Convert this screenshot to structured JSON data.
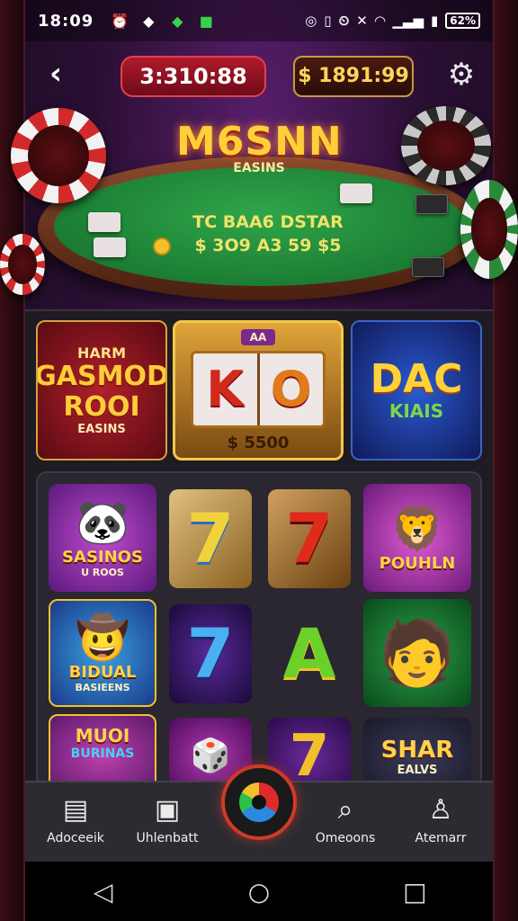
{
  "status_bar": {
    "time": "18:09",
    "icons": [
      "alarm-icon",
      "notification-icon",
      "game-icon",
      "chat-icon"
    ],
    "right_icons": [
      "nfc-icon",
      "vibrate-icon",
      "alarm-icon",
      "mute-icon",
      "wifi-icon",
      "signal-icon",
      "sim-icon"
    ],
    "battery": "62%"
  },
  "top_bar": {
    "back_icon": "back-arrow-icon",
    "balance_left": "3:310:88",
    "balance_right": "$ 1891:99",
    "settings_icon": "gear-icon"
  },
  "hero": {
    "logo_title": "M6SNN",
    "logo_subtitle": "EASINS",
    "felt_line1": "TC BAA6 DSTAR",
    "felt_line2": "$ 3O9 A3 59 $5"
  },
  "featured": [
    {
      "top": "HARM",
      "title": "GASMOD ROOI",
      "sub": "EASINS"
    },
    {
      "badge": "AA",
      "reel1": "K",
      "reel2": "O",
      "amount": "$ 5500"
    },
    {
      "title": "DAC",
      "sub": "KIAIS"
    }
  ],
  "grid": [
    {
      "caption": "SASINOS",
      "sub": "U ROOS"
    },
    {
      "symbol": "7"
    },
    {
      "symbol": "7"
    },
    {
      "caption": "POUHLN",
      "sub": ""
    },
    {
      "caption": "BIDUAL",
      "sub": "BASIEENS"
    },
    {
      "symbol": "7"
    },
    {
      "symbol": "A"
    },
    {
      "caption": "",
      "sub": ""
    },
    {
      "caption": "MUOI",
      "sub": "BURINAS"
    },
    {
      "caption": "",
      "sub": ""
    },
    {
      "symbol": "7"
    },
    {
      "caption": "SHAR",
      "sub": "EALVS"
    }
  ],
  "bottom_nav": [
    {
      "label": "Adoceeik",
      "icon": "clipboard-icon"
    },
    {
      "label": "Uhlenbatt",
      "icon": "slots-icon"
    },
    {
      "label": "",
      "icon": "roulette-icon"
    },
    {
      "label": "Omeoons",
      "icon": "search-icon"
    },
    {
      "label": "Atemarr",
      "icon": "profile-icon"
    }
  ],
  "system_nav": [
    "back-triangle-icon",
    "home-circle-icon",
    "recents-square-icon"
  ]
}
